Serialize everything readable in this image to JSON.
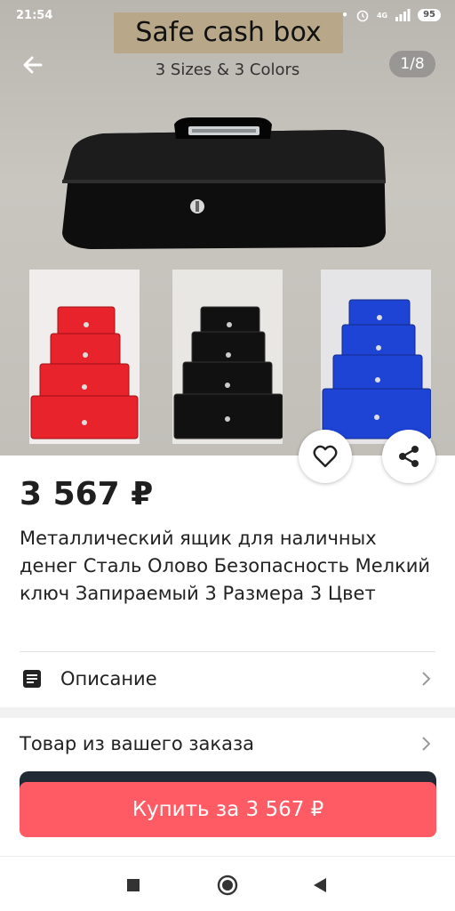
{
  "status": {
    "time": "21:54",
    "network": "4G",
    "battery": "95"
  },
  "gallery": {
    "banner_text": "Safe cash box",
    "subtitle": "3 Sizes & 3 Colors",
    "counter": "1/8",
    "thumb_colors": [
      "#e8232b",
      "#111111",
      "#1e44d6"
    ]
  },
  "product": {
    "price": "3 567 ₽",
    "title": "Металлический ящик для наличных денег Сталь Олово Безопасность Мелкий ключ Запираемый 3 Размера 3 Цвет"
  },
  "rows": {
    "description": "Описание",
    "order_item": "Товар из вашего заказа"
  },
  "buy_button": "Купить за 3 567 ₽",
  "icons": {
    "back": "arrow-left-icon",
    "favorite": "heart-icon",
    "share": "share-icon",
    "description": "document-icon",
    "chevron": "chevron-right-icon"
  }
}
